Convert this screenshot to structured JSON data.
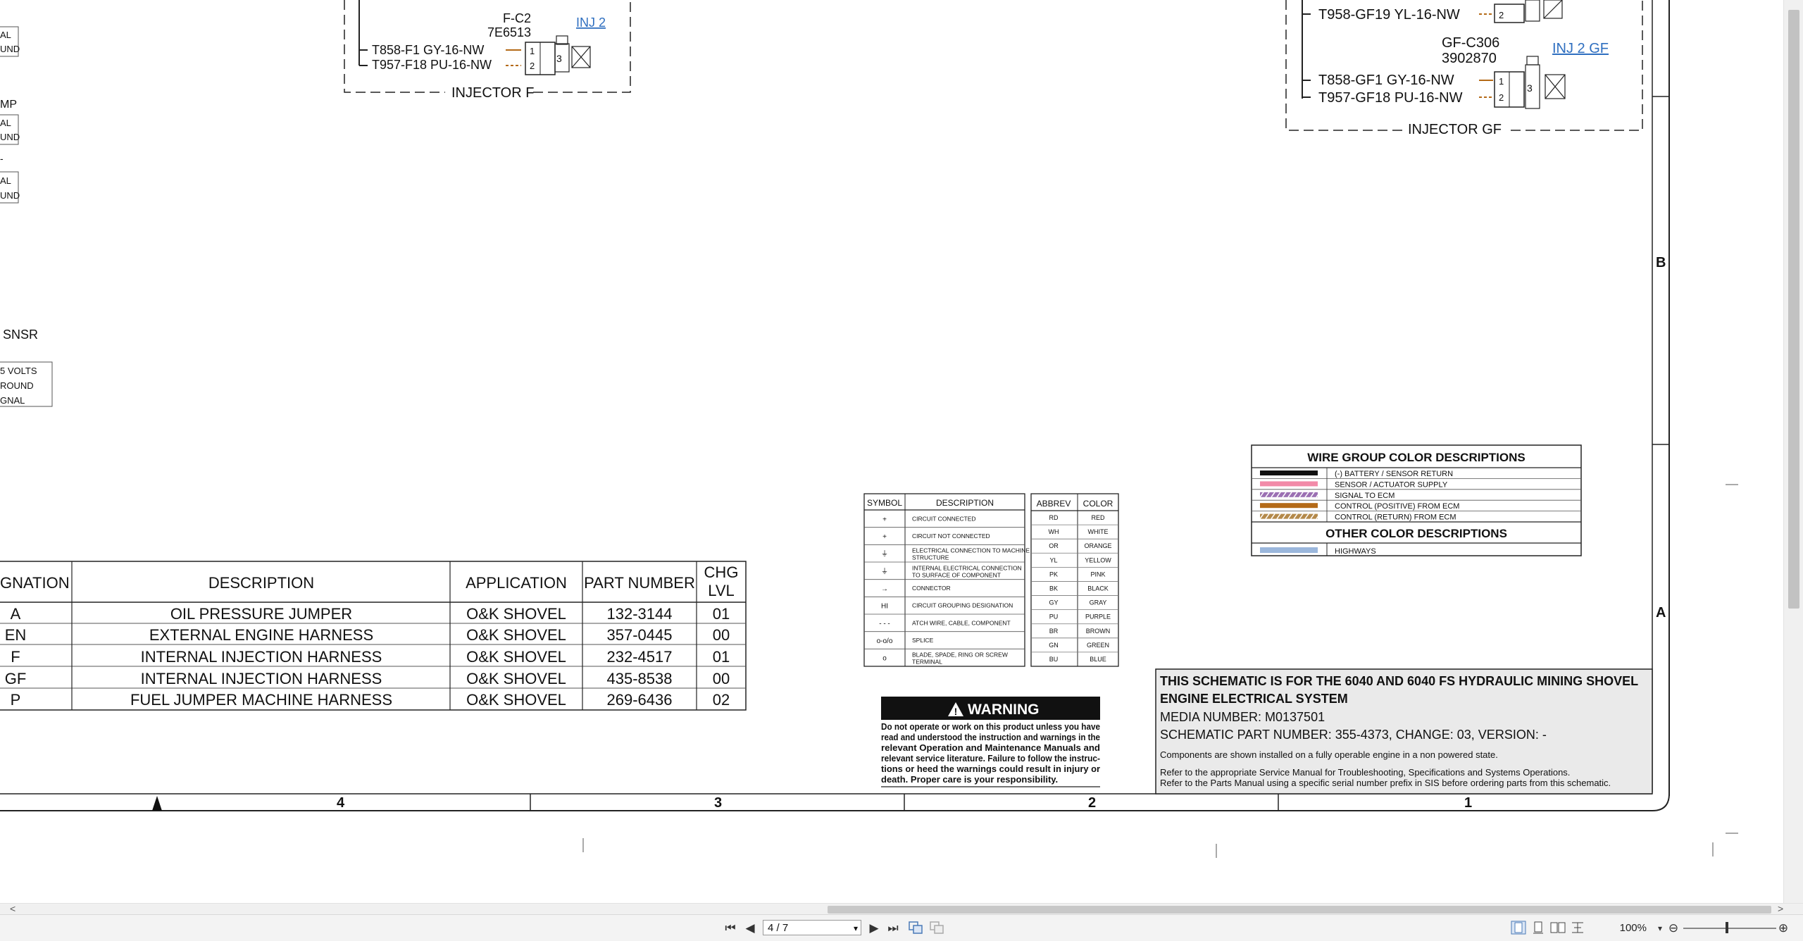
{
  "colors": {
    "accent": "#e77d22",
    "wire_orange": "#b46a17",
    "link": "#2f6fc0"
  },
  "injector_f": {
    "connector_id": "F-C2",
    "part": "7E6513",
    "link": "INJ 2",
    "wire1": "T858-F1 GY-16-NW",
    "wire2": "T957-F18 PU-16-NW",
    "box_label": "INJECTOR F",
    "pin1": "1",
    "pin2": "2",
    "pin3": "3"
  },
  "injector_gf": {
    "top_wire": "T958-GF19 YL-16-NW",
    "connector_id": "GF-C306",
    "part": "3902870",
    "link": "INJ 2 GF",
    "wire1": "T858-GF1 GY-16-NW",
    "wire2": "T957-GF18 PU-16-NW",
    "box_label": "INJECTOR GF",
    "pin1": "1",
    "pin2": "2",
    "pin3": "3"
  },
  "left_fragments": {
    "a1": "AL",
    "a2": "UND",
    "b0": "MP",
    "b1": "AL",
    "b2": "UND",
    "c0": "-",
    "c1": "AL",
    "c2": "UND",
    "snsr": "SNSR",
    "s1": "5 VOLTS",
    "s2": "ROUND",
    "s3": "GNAL"
  },
  "zones": {
    "b": "B",
    "a": "A"
  },
  "columns": [
    "4",
    "3",
    "2",
    "1"
  ],
  "harness_table": {
    "headers": [
      "GNATION",
      "DESCRIPTION",
      "APPLICATION",
      "PART NUMBER",
      "CHG",
      "LVL"
    ],
    "rows": [
      {
        "des": "A",
        "desc": "OIL PRESSURE JUMPER",
        "app": "O&K SHOVEL",
        "pn": "132-3144",
        "chg": "01"
      },
      {
        "des": "EN",
        "desc": "EXTERNAL ENGINE HARNESS",
        "app": "O&K SHOVEL",
        "pn": "357-0445",
        "chg": "00"
      },
      {
        "des": "F",
        "desc": "INTERNAL INJECTION HARNESS",
        "app": "O&K SHOVEL",
        "pn": "232-4517",
        "chg": "01"
      },
      {
        "des": "GF",
        "desc": "INTERNAL INJECTION HARNESS",
        "app": "O&K SHOVEL",
        "pn": "435-8538",
        "chg": "00"
      },
      {
        "des": "P",
        "desc": "FUEL JUMPER MACHINE HARNESS",
        "app": "O&K SHOVEL",
        "pn": "269-6436",
        "chg": "02"
      }
    ]
  },
  "symbol_table": {
    "headers": [
      "SYMBOL",
      "DESCRIPTION"
    ],
    "rows": [
      {
        "sym": "+",
        "desc": "CIRCUIT CONNECTED"
      },
      {
        "sym": "+",
        "desc": "CIRCUIT NOT CONNECTED"
      },
      {
        "sym": "⏚",
        "desc": "ELECTRICAL CONNECTION TO MACHINE STRUCTURE"
      },
      {
        "sym": "⏚",
        "desc": "INTERNAL ELECTRICAL CONNECTION TO SURFACE OF COMPONENT"
      },
      {
        "sym": "→",
        "desc": "CONNECTOR"
      },
      {
        "sym": "HI",
        "desc": "CIRCUIT GROUPING DESIGNATION"
      },
      {
        "sym": "- - -",
        "desc": "ATCH WIRE, CABLE, COMPONENT"
      },
      {
        "sym": "o-o/o",
        "desc": "SPLICE"
      },
      {
        "sym": "o",
        "desc": "BLADE, SPADE, RING OR SCREW TERMINAL"
      }
    ]
  },
  "color_table": {
    "headers": [
      "ABBREV",
      "COLOR"
    ],
    "rows": [
      [
        "RD",
        "RED"
      ],
      [
        "WH",
        "WHITE"
      ],
      [
        "OR",
        "ORANGE"
      ],
      [
        "YL",
        "YELLOW"
      ],
      [
        "PK",
        "PINK"
      ],
      [
        "BK",
        "BLACK"
      ],
      [
        "GY",
        "GRAY"
      ],
      [
        "PU",
        "PURPLE"
      ],
      [
        "BR",
        "BROWN"
      ],
      [
        "GN",
        "GREEN"
      ],
      [
        "BU",
        "BLUE"
      ]
    ]
  },
  "wire_group": {
    "title": "WIRE GROUP COLOR DESCRIPTIONS",
    "rows": [
      {
        "label": "(-) BATTERY / SENSOR RETURN",
        "color": "#111111"
      },
      {
        "label": "SENSOR / ACTUATOR SUPPLY",
        "color": "#f28aa8"
      },
      {
        "label": "SIGNAL TO ECM",
        "color": "#9b6fb3"
      },
      {
        "label": "CONTROL (POSITIVE) FROM ECM",
        "color": "#b46a17"
      },
      {
        "label": "CONTROL (RETURN) FROM ECM",
        "color": "#b4894a"
      }
    ],
    "other_title": "OTHER COLOR DESCRIPTIONS",
    "other_rows": [
      {
        "label": "HIGHWAYS",
        "color": "#9bb7dc"
      }
    ]
  },
  "warning": {
    "title": "WARNING",
    "lines": [
      "Do not operate or work on this product unless you have",
      "read and understood the instruction and warnings in the",
      "relevant Operation and Maintenance Manuals and",
      "relevant service literature. Failure to follow the instruc-",
      "tions or heed the warnings could result in injury or",
      "death. Proper care is your responsibility."
    ]
  },
  "title_block": {
    "line1": "THIS SCHEMATIC IS FOR THE 6040 AND 6040 FS HYDRAULIC MINING SHOVEL",
    "line2": "ENGINE ELECTRICAL SYSTEM",
    "media": "MEDIA NUMBER: M0137501",
    "part": "SCHEMATIC PART NUMBER: 355-4373, CHANGE: 03, VERSION: -",
    "note1": "Components are shown installed on a fully operable engine in a non powered state.",
    "note2": "Refer to the appropriate Service Manual for Troubleshooting, Specifications and Systems Operations.",
    "note3": "Refer to the Parts Manual using a specific serial number prefix in SIS before ordering parts from this schematic."
  },
  "toolbar": {
    "page": "4 / 7",
    "zoom": "100%",
    "first": "⏮",
    "prev": "◀",
    "next": "▶",
    "last": "⏭",
    "zoom_out": "⊖",
    "zoom_in": "⊕",
    "caret": "▾"
  },
  "hscroll": {
    "left_arrow": "<",
    "right_arrow": ">"
  }
}
